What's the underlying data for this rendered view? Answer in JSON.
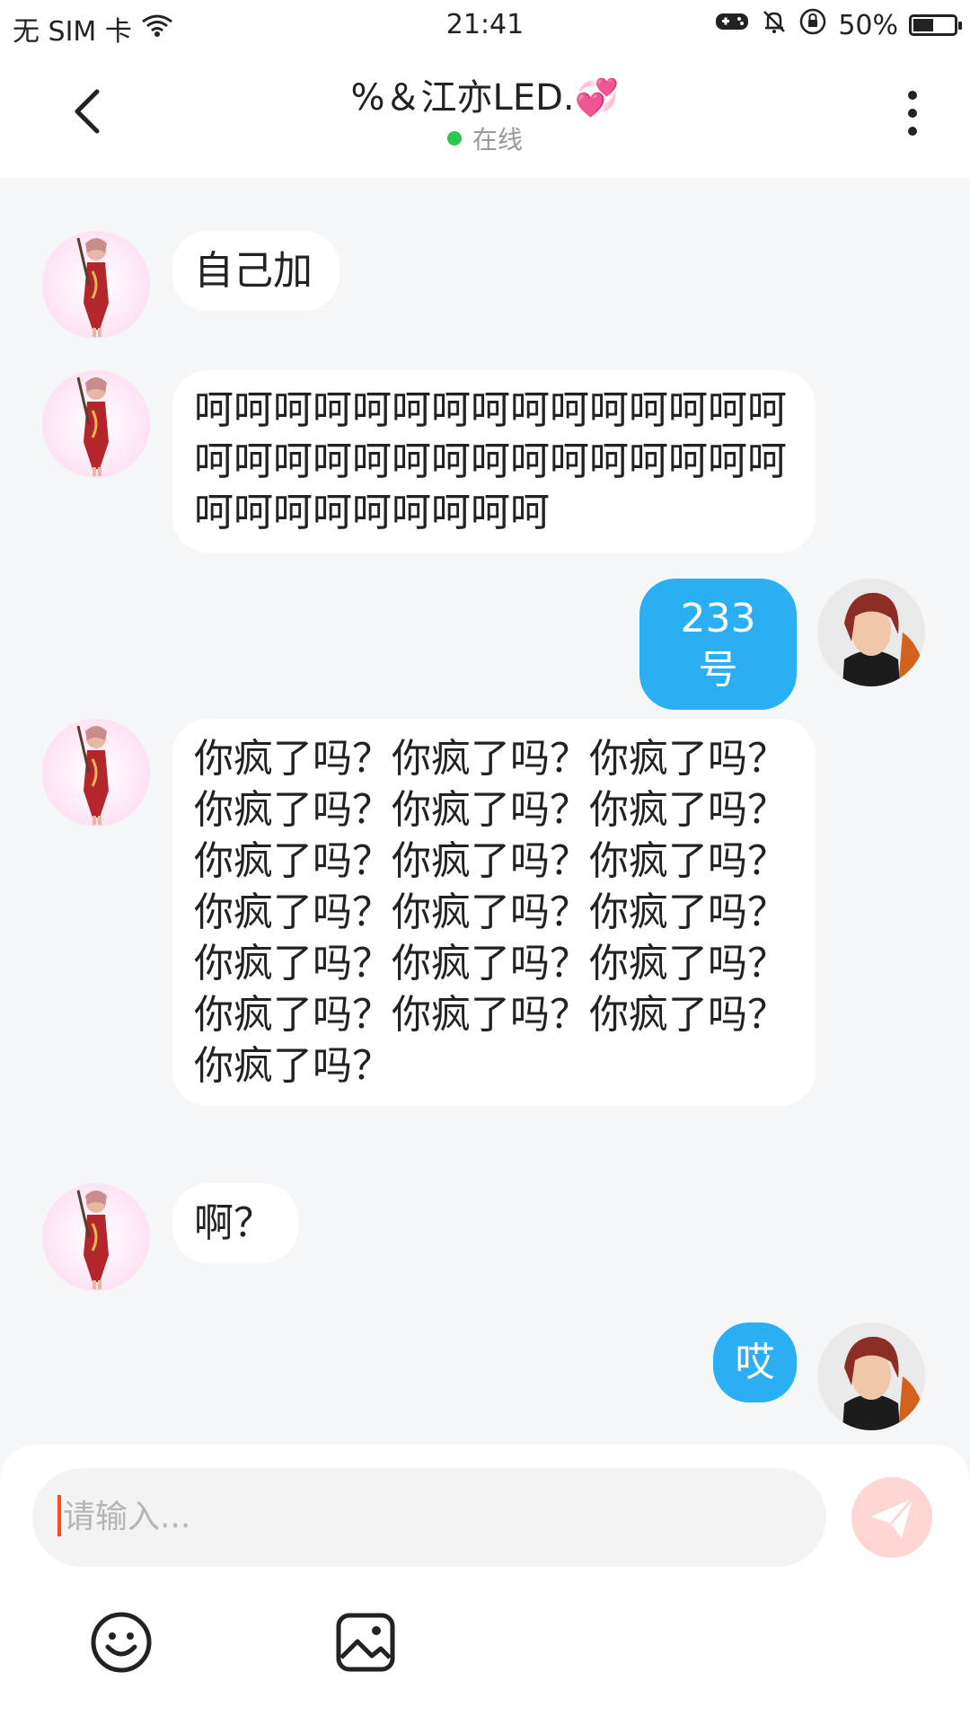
{
  "status_bar": {
    "carrier": "无 SIM 卡",
    "time": "21:41",
    "battery": "50%",
    "battery_level": 0.5
  },
  "header": {
    "title": "%＆江亦LED.💞",
    "status": "在线"
  },
  "messages": [
    {
      "side": "left",
      "text": "自己加"
    },
    {
      "side": "left",
      "text": "呵呵呵呵呵呵呵呵呵呵呵呵呵呵呵呵呵呵呵呵呵呵呵呵呵呵呵呵呵呵呵呵呵呵呵呵呵呵呵"
    },
    {
      "side": "right",
      "text": "233号"
    },
    {
      "side": "left",
      "text": "你疯了吗？你疯了吗？你疯了吗？你疯了吗？你疯了吗？你疯了吗？你疯了吗？你疯了吗？你疯了吗？你疯了吗？你疯了吗？你疯了吗？你疯了吗？你疯了吗？你疯了吗？你疯了吗？你疯了吗？你疯了吗？你疯了吗？"
    },
    {
      "side": "left",
      "text": "啊？"
    },
    {
      "side": "right",
      "text": "哎"
    }
  ],
  "input": {
    "placeholder": "请输入..."
  },
  "colors": {
    "accent": "#2aaef4",
    "online": "#2bc84b",
    "send": "#ffd6d4"
  },
  "icons": [
    "back-arrow-icon",
    "more-vertical-icon",
    "send-icon",
    "emoji-icon",
    "image-icon"
  ]
}
